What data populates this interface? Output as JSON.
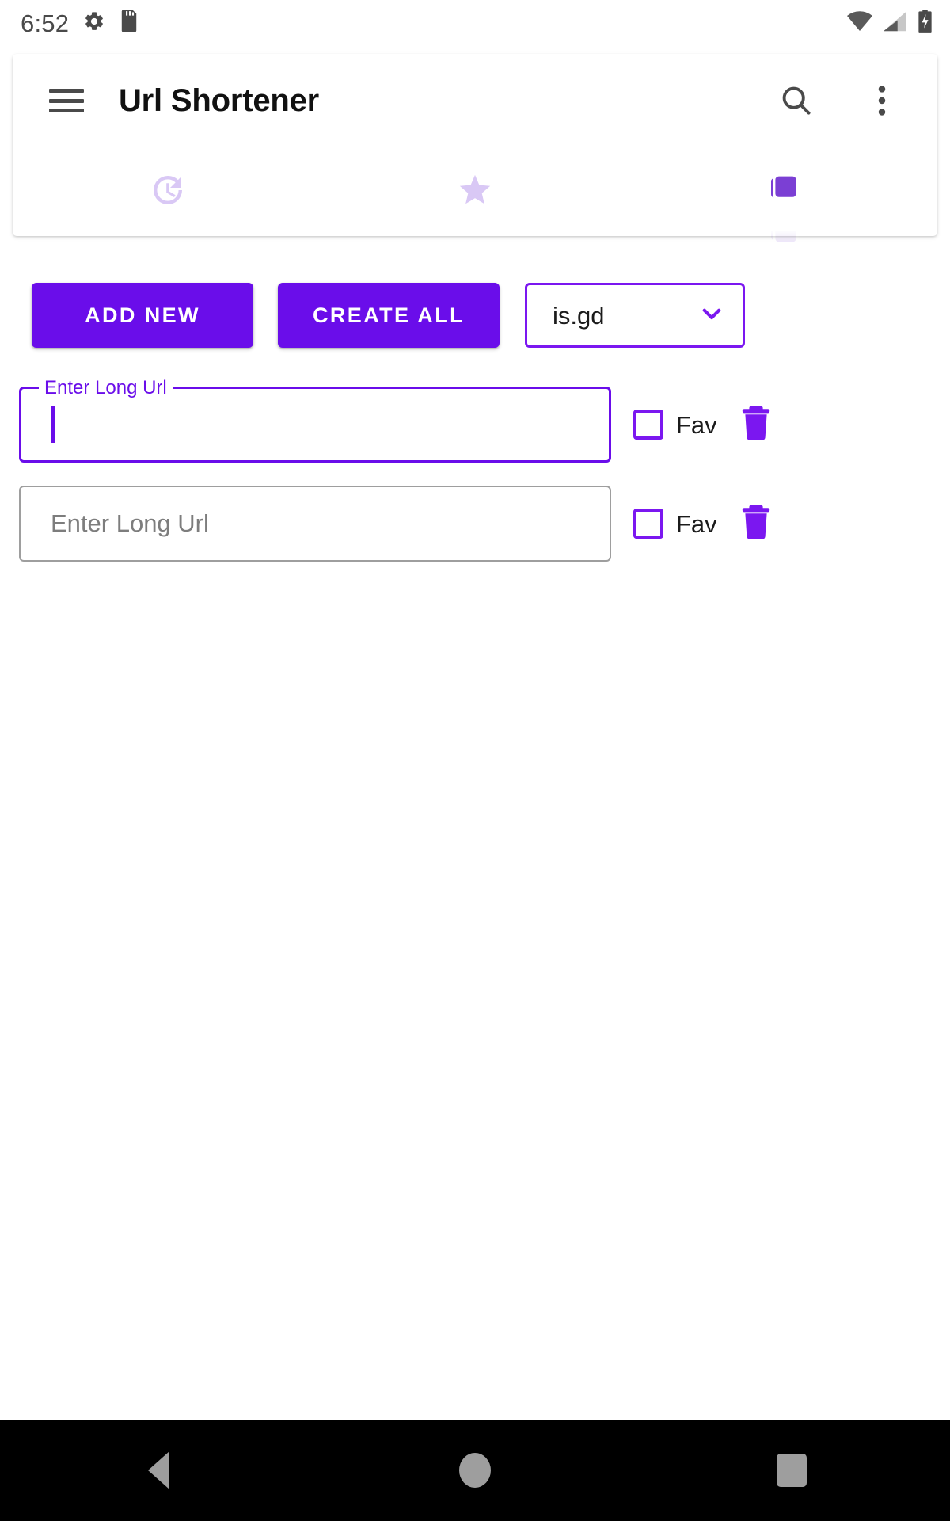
{
  "status_bar": {
    "clock": "6:52",
    "left_icons": [
      "gear-icon",
      "sd-card-icon"
    ],
    "right_icons": [
      "wifi-icon",
      "cellular-signal-icon",
      "battery-charging-icon"
    ]
  },
  "app_bar": {
    "menu_icon": "hamburger-menu-icon",
    "title": "Url Shortener",
    "search_icon": "search-icon",
    "overflow_icon": "more-vert-icon"
  },
  "tabs": [
    {
      "name": "history",
      "icon": "history-icon",
      "active": false
    },
    {
      "name": "favorites",
      "icon": "star-icon",
      "active": false
    },
    {
      "name": "shorten",
      "icon": "copy-icon",
      "active": true
    }
  ],
  "actions": {
    "add_new_label": "ADD NEW",
    "create_all_label": "CREATE ALL",
    "service_select": {
      "value": "is.gd",
      "chevron_icon": "chevron-down-icon"
    }
  },
  "url_rows": [
    {
      "label": "Enter Long Url",
      "value": "",
      "placeholder": "Enter Long Url",
      "focused": true,
      "fav_label": "Fav",
      "fav_checked": false,
      "delete_icon": "trash-icon"
    },
    {
      "label": "Enter Long Url",
      "value": "",
      "placeholder": "Enter Long Url",
      "focused": false,
      "fav_label": "Fav",
      "fav_checked": false,
      "delete_icon": "trash-icon"
    }
  ],
  "nav_bar": {
    "back": "back-triangle-icon",
    "home": "home-circle-icon",
    "recents": "recents-square-icon"
  },
  "colors": {
    "primary": "#6A0DEA",
    "primary_border": "#7B17F0",
    "tab_inactive": "#D9C8F5",
    "page_bg": "#FFFFFF",
    "nav_bg": "#000000",
    "nav_icon": "#9E9E9E",
    "status_icon": "#4A4A4A"
  }
}
